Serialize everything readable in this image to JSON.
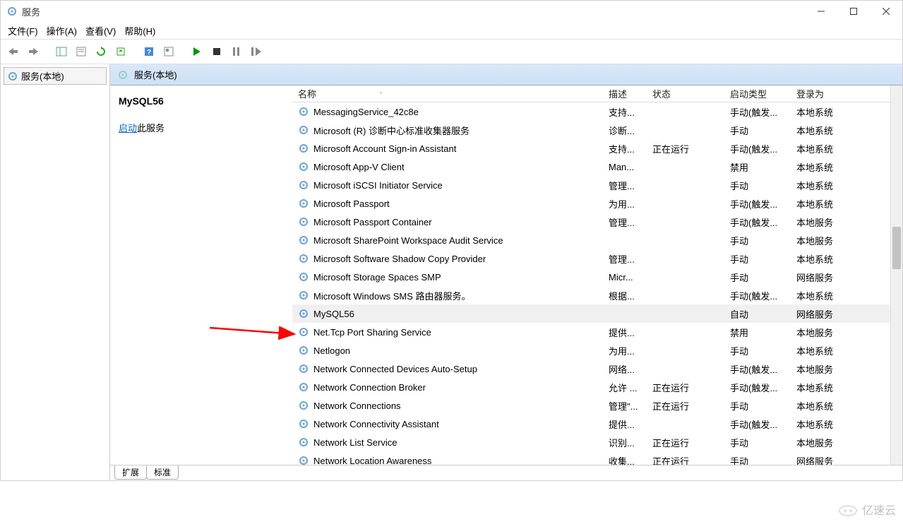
{
  "window": {
    "title": "服务"
  },
  "menubar": {
    "file": "文件(F)",
    "action": "操作(A)",
    "view": "查看(V)",
    "help": "帮助(H)"
  },
  "left": {
    "node": "服务(本地)"
  },
  "right_header": {
    "label": "服务(本地)"
  },
  "detail": {
    "title": "MySQL56",
    "start_link": "启动",
    "start_suffix": "此服务"
  },
  "columns": {
    "name": "名称",
    "desc": "描述",
    "status": "状态",
    "startup": "启动类型",
    "login": "登录为"
  },
  "tabs": {
    "extended": "扩展",
    "standard": "标准"
  },
  "watermark": "亿速云",
  "services": [
    {
      "name": "MessagingService_42c8e",
      "desc": "支持...",
      "status": "",
      "startup": "手动(触发...",
      "login": "本地系统"
    },
    {
      "name": "Microsoft (R) 诊断中心标准收集器服务",
      "desc": "诊断...",
      "status": "",
      "startup": "手动",
      "login": "本地系统"
    },
    {
      "name": "Microsoft Account Sign-in Assistant",
      "desc": "支持...",
      "status": "正在运行",
      "startup": "手动(触发...",
      "login": "本地系统"
    },
    {
      "name": "Microsoft App-V Client",
      "desc": "Man...",
      "status": "",
      "startup": "禁用",
      "login": "本地系统"
    },
    {
      "name": "Microsoft iSCSI Initiator Service",
      "desc": "管理...",
      "status": "",
      "startup": "手动",
      "login": "本地系统"
    },
    {
      "name": "Microsoft Passport",
      "desc": "为用...",
      "status": "",
      "startup": "手动(触发...",
      "login": "本地系统"
    },
    {
      "name": "Microsoft Passport Container",
      "desc": "管理...",
      "status": "",
      "startup": "手动(触发...",
      "login": "本地服务"
    },
    {
      "name": "Microsoft SharePoint Workspace Audit Service",
      "desc": "",
      "status": "",
      "startup": "手动",
      "login": "本地服务"
    },
    {
      "name": "Microsoft Software Shadow Copy Provider",
      "desc": "管理...",
      "status": "",
      "startup": "手动",
      "login": "本地系统"
    },
    {
      "name": "Microsoft Storage Spaces SMP",
      "desc": "Micr...",
      "status": "",
      "startup": "手动",
      "login": "网络服务"
    },
    {
      "name": "Microsoft Windows SMS 路由器服务。",
      "desc": "根据...",
      "status": "",
      "startup": "手动(触发...",
      "login": "本地系统"
    },
    {
      "name": "MySQL56",
      "desc": "",
      "status": "",
      "startup": "自动",
      "login": "网络服务",
      "highlight": true
    },
    {
      "name": "Net.Tcp Port Sharing Service",
      "desc": "提供...",
      "status": "",
      "startup": "禁用",
      "login": "本地服务"
    },
    {
      "name": "Netlogon",
      "desc": "为用...",
      "status": "",
      "startup": "手动",
      "login": "本地系统"
    },
    {
      "name": "Network Connected Devices Auto-Setup",
      "desc": "网络...",
      "status": "",
      "startup": "手动(触发...",
      "login": "本地服务"
    },
    {
      "name": "Network Connection Broker",
      "desc": "允许 ...",
      "status": "正在运行",
      "startup": "手动(触发...",
      "login": "本地系统"
    },
    {
      "name": "Network Connections",
      "desc": "管理\"...",
      "status": "正在运行",
      "startup": "手动",
      "login": "本地系统"
    },
    {
      "name": "Network Connectivity Assistant",
      "desc": "提供...",
      "status": "",
      "startup": "手动(触发...",
      "login": "本地系统"
    },
    {
      "name": "Network List Service",
      "desc": "识别...",
      "status": "正在运行",
      "startup": "手动",
      "login": "本地服务"
    },
    {
      "name": "Network Location Awareness",
      "desc": "收集...",
      "status": "正在运行",
      "startup": "手动",
      "login": "网络服务"
    }
  ]
}
